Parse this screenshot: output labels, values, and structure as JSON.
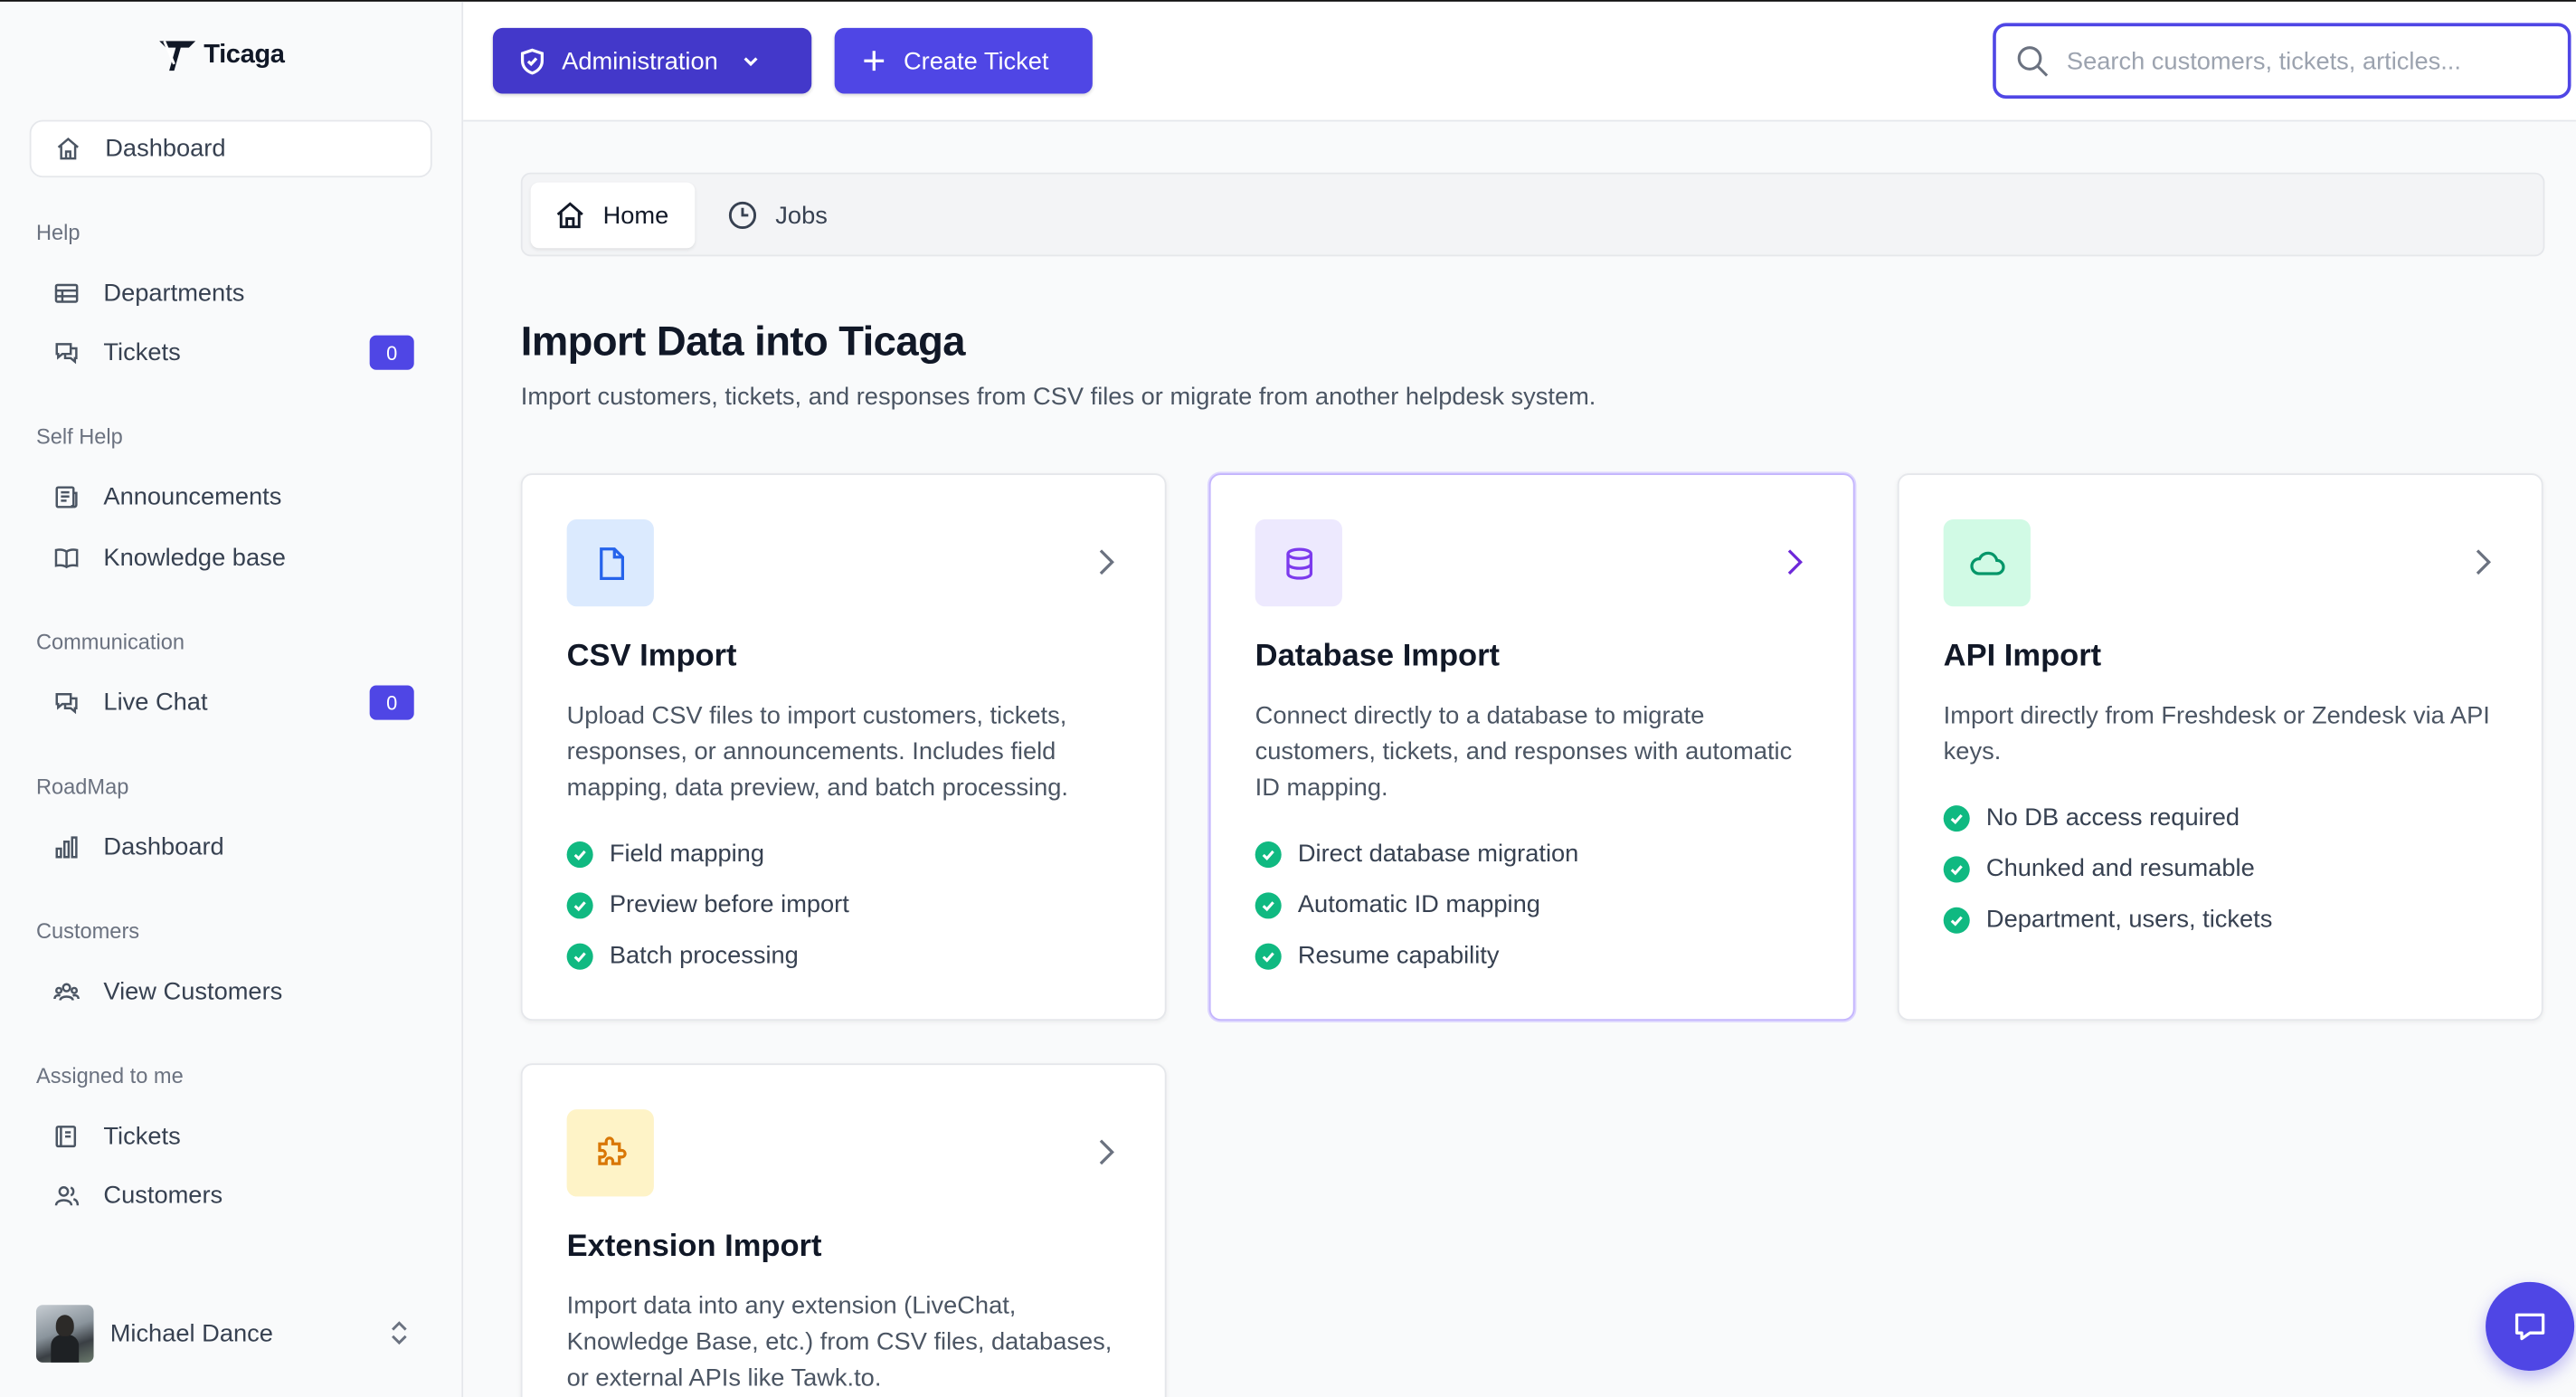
{
  "app": {
    "name": "Ticaga"
  },
  "sidebar": {
    "dashboard": "Dashboard",
    "sections": [
      {
        "title": "Help",
        "items": [
          {
            "label": "Departments"
          },
          {
            "label": "Tickets",
            "badge": "0"
          }
        ]
      },
      {
        "title": "Self Help",
        "items": [
          {
            "label": "Announcements"
          },
          {
            "label": "Knowledge base"
          }
        ]
      },
      {
        "title": "Communication",
        "items": [
          {
            "label": "Live Chat",
            "badge": "0"
          }
        ]
      },
      {
        "title": "RoadMap",
        "items": [
          {
            "label": "Dashboard"
          }
        ]
      },
      {
        "title": "Customers",
        "items": [
          {
            "label": "View Customers"
          }
        ]
      },
      {
        "title": "Assigned to me",
        "items": [
          {
            "label": "Tickets"
          },
          {
            "label": "Customers"
          }
        ]
      }
    ],
    "user": {
      "name": "Michael Dance"
    }
  },
  "topbar": {
    "admin_label": "Administration",
    "create_label": "Create Ticket",
    "search_placeholder": "Search customers, tickets, articles..."
  },
  "tabs": [
    {
      "label": "Home"
    },
    {
      "label": "Jobs"
    }
  ],
  "page": {
    "title": "Import Data into Ticaga",
    "subtitle": "Import customers, tickets, and responses from CSV files or migrate from another helpdesk system."
  },
  "cards": [
    {
      "title": "CSV Import",
      "description": "Upload CSV files to import customers, tickets, responses, or announcements. Includes field mapping, data preview, and batch processing.",
      "features": [
        "Field mapping",
        "Preview before import",
        "Batch processing"
      ],
      "icon": "file-icon",
      "icon_bg": "#dbeafe",
      "icon_color": "#2563eb"
    },
    {
      "title": "Database Import",
      "description": "Connect directly to a database to migrate customers, tickets, and responses with automatic ID mapping.",
      "features": [
        "Direct database migration",
        "Automatic ID mapping",
        "Resume capability"
      ],
      "icon": "database-icon",
      "icon_bg": "#ede9fe",
      "icon_color": "#7c3aed"
    },
    {
      "title": "API Import",
      "description": "Import directly from Freshdesk or Zendesk via API keys.",
      "features": [
        "No DB access required",
        "Chunked and resumable",
        "Department, users, tickets"
      ],
      "icon": "cloud-icon",
      "icon_bg": "#d1fae5",
      "icon_color": "#059669"
    },
    {
      "title": "Extension Import",
      "description": "Import data into any extension (LiveChat, Knowledge Base, etc.) from CSV files, databases, or external APIs like Tawk.to.",
      "features": [],
      "icon": "puzzle-icon",
      "icon_bg": "#fef3c7",
      "icon_color": "#d97706"
    }
  ],
  "colors": {
    "primary": "#4f46e5",
    "success": "#10b981",
    "text": "#111827",
    "muted": "#4b5563"
  }
}
